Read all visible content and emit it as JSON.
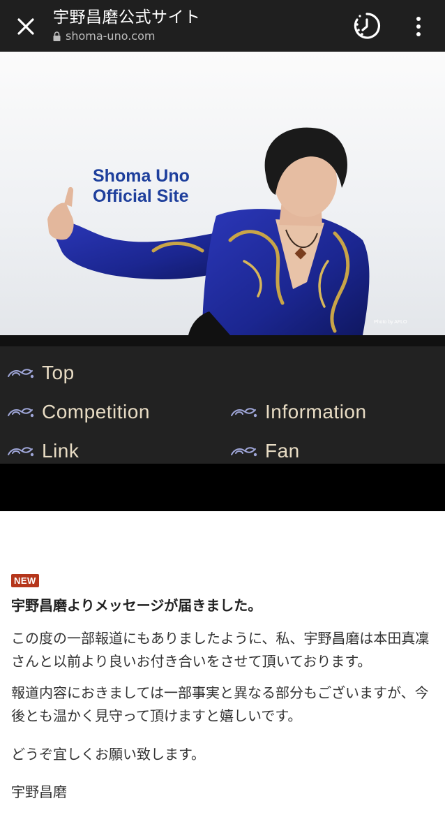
{
  "browser": {
    "page_title": "宇野昌磨公式サイト",
    "url": "shoma-uno.com"
  },
  "hero": {
    "title_line1": "Shoma Uno",
    "title_line2": "Official Site",
    "photo_credit": "Photo by AFLO"
  },
  "nav": {
    "items": [
      {
        "label": "Top"
      },
      {
        "label": "Competition"
      },
      {
        "label": "Information"
      },
      {
        "label": "Link"
      },
      {
        "label": "Fan"
      }
    ],
    "accent_color": "#e8dcc4",
    "icon": "swirl-ornament-icon"
  },
  "news": {
    "badge": "NEW",
    "badge_color": "#b5361b",
    "headline": "宇野昌磨よりメッセージが届きました。",
    "paragraphs": [
      "この度の一部報道にもありましたように、私、宇野昌磨は本田真凜さんと以前より良いお付き合いをさせて頂いております。",
      "報道内容におきましては一部事実と異なる部分もございますが、今後とも温かく見守って頂けますと嬉しいです。",
      "どうぞ宜しくお願い致します。",
      "宇野昌磨"
    ]
  }
}
